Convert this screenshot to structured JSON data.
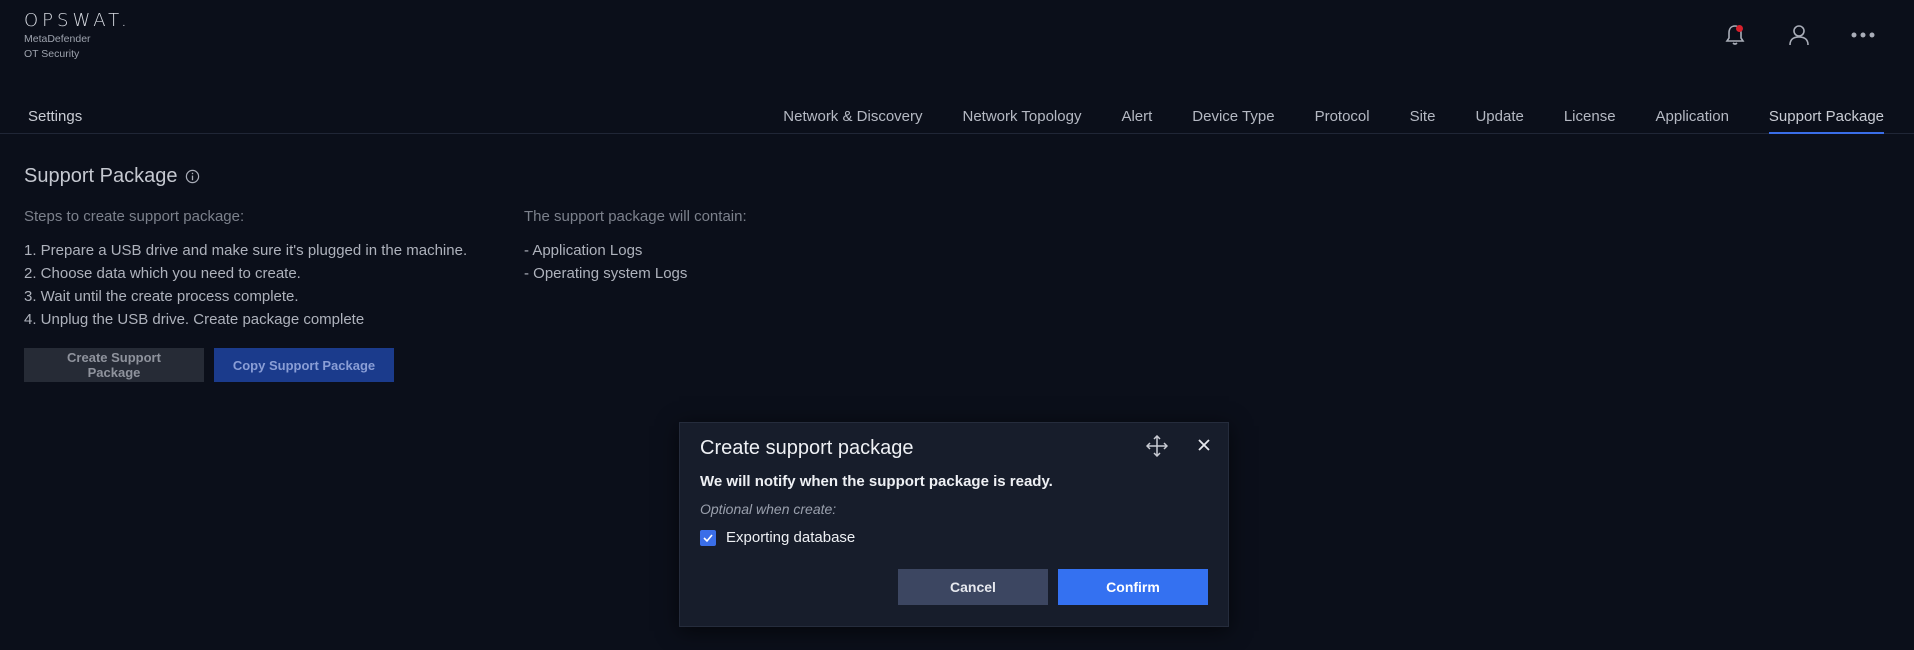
{
  "brand": {
    "logo_text": "OPSWAT.",
    "product_line1": "MetaDefender",
    "product_line2": "OT Security"
  },
  "header_icons": [
    "bell-icon",
    "user-icon",
    "more-icon"
  ],
  "nav": {
    "title": "Settings",
    "tabs": [
      {
        "label": "Network & Discovery"
      },
      {
        "label": "Network Topology"
      },
      {
        "label": "Alert"
      },
      {
        "label": "Device Type"
      },
      {
        "label": "Protocol"
      },
      {
        "label": "Site"
      },
      {
        "label": "Update"
      },
      {
        "label": "License"
      },
      {
        "label": "Application"
      },
      {
        "label": "Support Package",
        "active": true
      }
    ]
  },
  "page": {
    "title": "Support Package",
    "steps_heading": "Steps to create support package:",
    "steps": [
      "1. Prepare a USB drive and make sure it's plugged in the machine.",
      "2. Choose data which you need to create.",
      "3. Wait until the create process complete.",
      "4. Unplug the USB drive. Create package complete"
    ],
    "contains_heading": "The support package will contain:",
    "contains": [
      "- Application Logs",
      "- Operating system Logs"
    ],
    "create_button": "Create Support Package",
    "copy_button": "Copy Support Package"
  },
  "dialog": {
    "title": "Create support package",
    "message": "We will notify when the support package is ready.",
    "optional_label": "Optional when create:",
    "checkbox_label": "Exporting database",
    "checkbox_checked": true,
    "cancel_label": "Cancel",
    "confirm_label": "Confirm"
  },
  "colors": {
    "background": "#0b0f1a",
    "accent": "#3471f1",
    "dialog_bg": "#171d2b"
  }
}
